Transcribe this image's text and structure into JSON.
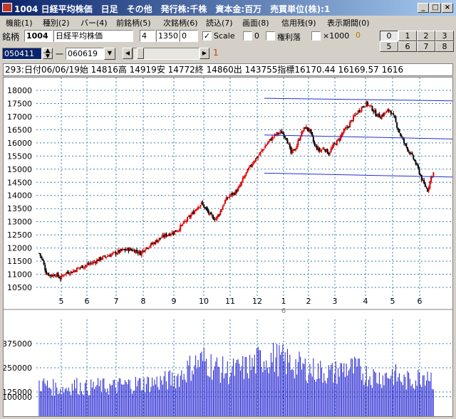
{
  "window": {
    "title": "1004 日経平均株価　日足　その他　発行株:千株　資本金:百万　売買単位(株):1",
    "buttons": {
      "minimize": "_",
      "maximize": "□",
      "close": "×"
    }
  },
  "menu": [
    "機能(1)",
    "種別(2)",
    "バー(4)",
    "前銘柄(5)",
    "次銘柄(6)",
    "読込(7)",
    "画面(8)",
    "信用残(9)",
    "表示期間(0)"
  ],
  "toolbar": {
    "symbol_label": "銘柄",
    "symbol_code": "1004",
    "symbol_name": "日経平均株価",
    "field_a": "4",
    "field_b": "1350",
    "field_c": "0",
    "scale_label": "Scale",
    "scale_checked": "✓",
    "zero_label": "0",
    "rights_label": "権利落",
    "x1000_label": "×1000",
    "x1000_value": "0",
    "grid_buttons": [
      "0",
      "1",
      "2",
      "3",
      "5",
      "6",
      "7",
      "8"
    ],
    "date_from": "050411",
    "dash": "一",
    "date_to": "060619",
    "scroll_marker": "1"
  },
  "info_line": "293:日付06/06/19始 14816高 14919安 14772終 14860出 143755指標16170.44   16169.57   1616",
  "chart_data": [
    {
      "type": "candlestick",
      "title": "",
      "ylim": [
        10500,
        18000
      ],
      "yticks": [
        18000,
        17500,
        17000,
        16500,
        16000,
        15500,
        15000,
        14500,
        14000,
        13500,
        13000,
        12500,
        12000,
        11500,
        11000,
        10500
      ],
      "ytick_labels": [
        "18000",
        "17500",
        "17000",
        "16500",
        "16000",
        "15500",
        "15000",
        "14500",
        "14000",
        "13500",
        "13000",
        "12500",
        "12000",
        "11500",
        "11000",
        "10500"
      ],
      "x_month_labels": [
        "5",
        "6",
        "7",
        "8",
        "9",
        "10",
        "11",
        "12",
        "1",
        "2",
        "3",
        "4",
        "5",
        "6"
      ],
      "year_label": "6",
      "close_path": [
        [
          0,
          11800
        ],
        [
          3,
          11500
        ],
        [
          6,
          11050
        ],
        [
          10,
          10950
        ],
        [
          14,
          11000
        ],
        [
          18,
          10850
        ],
        [
          22,
          11050
        ],
        [
          28,
          11100
        ],
        [
          34,
          11250
        ],
        [
          40,
          11350
        ],
        [
          46,
          11450
        ],
        [
          52,
          11600
        ],
        [
          58,
          11700
        ],
        [
          64,
          11800
        ],
        [
          70,
          11900
        ],
        [
          76,
          11950
        ],
        [
          82,
          11900
        ],
        [
          86,
          11800
        ],
        [
          90,
          12000
        ],
        [
          96,
          12150
        ],
        [
          102,
          12350
        ],
        [
          108,
          12500
        ],
        [
          114,
          12600
        ],
        [
          118,
          12700
        ],
        [
          124,
          13000
        ],
        [
          130,
          13300
        ],
        [
          134,
          13550
        ],
        [
          138,
          13700
        ],
        [
          142,
          13450
        ],
        [
          146,
          13200
        ],
        [
          150,
          13100
        ],
        [
          154,
          13400
        ],
        [
          158,
          13800
        ],
        [
          162,
          14000
        ],
        [
          166,
          14100
        ],
        [
          170,
          14300
        ],
        [
          174,
          14700
        ],
        [
          178,
          15000
        ],
        [
          182,
          15300
        ],
        [
          186,
          15500
        ],
        [
          190,
          15750
        ],
        [
          194,
          16000
        ],
        [
          198,
          16200
        ],
        [
          202,
          16350
        ],
        [
          206,
          16400
        ],
        [
          210,
          16200
        ],
        [
          214,
          15600
        ],
        [
          218,
          15800
        ],
        [
          222,
          16300
        ],
        [
          226,
          16600
        ],
        [
          230,
          16450
        ],
        [
          234,
          15900
        ],
        [
          238,
          15700
        ],
        [
          242,
          15800
        ],
        [
          246,
          15600
        ],
        [
          250,
          15900
        ],
        [
          254,
          16100
        ],
        [
          258,
          16400
        ],
        [
          262,
          16600
        ],
        [
          266,
          16900
        ],
        [
          270,
          17150
        ],
        [
          274,
          17350
        ],
        [
          278,
          17500
        ],
        [
          282,
          17350
        ],
        [
          286,
          17100
        ],
        [
          290,
          17000
        ],
        [
          294,
          17150
        ],
        [
          298,
          17250
        ],
        [
          302,
          16900
        ],
        [
          306,
          16400
        ],
        [
          310,
          16000
        ],
        [
          314,
          15700
        ],
        [
          318,
          15400
        ],
        [
          322,
          15000
        ],
        [
          326,
          14500
        ],
        [
          330,
          14200
        ],
        [
          333,
          14700
        ],
        [
          335,
          14860
        ]
      ],
      "trend_lines": [
        {
          "name": "top",
          "y_start": 17700,
          "y_end": 17600
        },
        {
          "name": "middle",
          "y_start": 16300,
          "y_end": 16150
        },
        {
          "name": "bottom",
          "y_start": 14850,
          "y_end": 14700
        }
      ]
    },
    {
      "type": "bar",
      "title": "",
      "ylim": [
        0,
        500000
      ],
      "yticks": [
        375000,
        250000,
        125000,
        100000
      ],
      "ytick_labels": [
        "375000",
        "250000",
        "125000",
        "100000"
      ],
      "volume_profile": [
        [
          0,
          170000
        ],
        [
          10,
          150000
        ],
        [
          20,
          140000
        ],
        [
          30,
          160000
        ],
        [
          40,
          145000
        ],
        [
          50,
          155000
        ],
        [
          60,
          150000
        ],
        [
          70,
          160000
        ],
        [
          80,
          165000
        ],
        [
          90,
          170000
        ],
        [
          100,
          175000
        ],
        [
          110,
          185000
        ],
        [
          120,
          210000
        ],
        [
          130,
          260000
        ],
        [
          140,
          290000
        ],
        [
          150,
          250000
        ],
        [
          160,
          230000
        ],
        [
          170,
          240000
        ],
        [
          180,
          260000
        ],
        [
          190,
          300000
        ],
        [
          200,
          300000
        ],
        [
          210,
          280000
        ],
        [
          220,
          260000
        ],
        [
          230,
          240000
        ],
        [
          240,
          230000
        ],
        [
          250,
          220000
        ],
        [
          260,
          250000
        ],
        [
          270,
          240000
        ],
        [
          280,
          210000
        ],
        [
          290,
          200000
        ],
        [
          300,
          220000
        ],
        [
          310,
          180000
        ],
        [
          320,
          190000
        ],
        [
          330,
          230000
        ],
        [
          335,
          180000
        ]
      ]
    }
  ],
  "colors": {
    "up": "#e00000",
    "down": "#000000",
    "grid": "#3b7ea1",
    "trend": "#1f2fd0",
    "volume": "#1f1fd0",
    "axis_label": "#808080"
  }
}
